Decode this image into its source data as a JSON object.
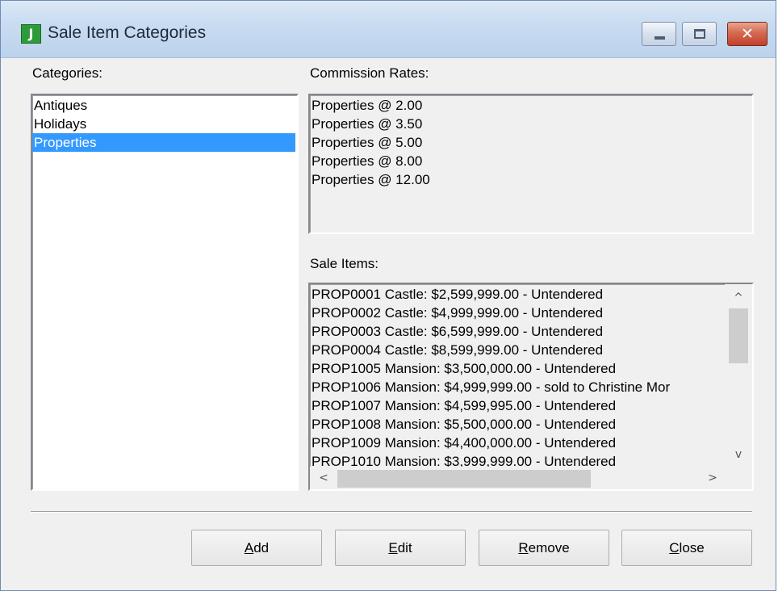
{
  "window": {
    "title": "Sale Item Categories",
    "app_icon_letter": "J"
  },
  "title_controls": {
    "minimize": "minimize",
    "maximize": "maximize",
    "close_glyph": "✕"
  },
  "categories": {
    "label": "Categories:",
    "items": [
      "Antiques",
      "Holidays",
      "Properties"
    ],
    "selected": "Properties"
  },
  "commission_rates": {
    "label": "Commission Rates:",
    "items": [
      "Properties @ 2.00",
      "Properties @ 3.50",
      "Properties @ 5.00",
      "Properties @ 8.00",
      "Properties @ 12.00"
    ]
  },
  "sale_items": {
    "label": "Sale Items:",
    "items": [
      "PROP0001 Castle: $2,599,999.00 - Untendered",
      "PROP0002 Castle: $4,999,999.00 - Untendered",
      "PROP0003 Castle: $6,599,999.00 - Untendered",
      "PROP0004 Castle: $8,599,999.00 - Untendered",
      "PROP1005 Mansion: $3,500,000.00 - Untendered",
      "PROP1006 Mansion: $4,999,999.00 - sold to Christine Mor",
      "PROP1007 Mansion: $4,599,995.00 - Untendered",
      "PROP1008 Mansion: $5,500,000.00 - Untendered",
      "PROP1009 Mansion: $4,400,000.00 - Untendered",
      "PROP1010 Mansion: $3,999,999.00 - Untendered"
    ]
  },
  "scroll_glyphs": {
    "up": "^",
    "down": "v",
    "left": "<",
    "right": ">"
  },
  "buttons": {
    "add": {
      "first": "A",
      "rest": "dd"
    },
    "edit": {
      "first": "E",
      "rest": "dit"
    },
    "remove": {
      "first": "R",
      "rest": "emove"
    },
    "close": {
      "first": "C",
      "rest": "lose"
    }
  },
  "colors": {
    "selection": "#3399ff",
    "close_button": "#c2402a",
    "app_icon": "#2e9b3a"
  }
}
